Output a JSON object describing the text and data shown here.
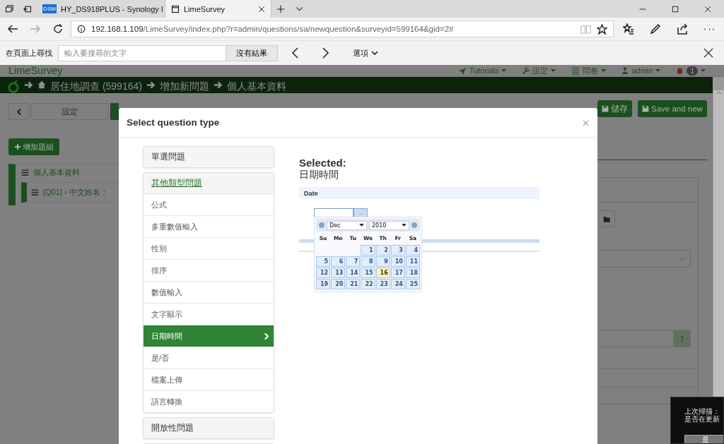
{
  "browser": {
    "tabs": [
      {
        "title": "HY_DS918PLUS - Synology I",
        "icon_text": "DSM",
        "selected": false
      },
      {
        "title": "LimeSurvey",
        "selected": true
      }
    ],
    "url_host": "192.168.1.109",
    "url_path": "/LimeSurvey/index.php?r=admin/questions/sa/newquestion&surveyid=599164&gid=2#"
  },
  "find_bar": {
    "label": "在頁面上尋找",
    "placeholder": "輸入要搜尋的文字",
    "result": "沒有結果",
    "options": "選項"
  },
  "navbar": {
    "brand": "LimeSurvey",
    "menus": [
      {
        "label": "Tutorials",
        "kind": "rocket"
      },
      {
        "label": "設定",
        "kind": "wrench"
      },
      {
        "label": "問卷",
        "kind": "list"
      },
      {
        "label": "admin",
        "kind": "user"
      }
    ],
    "notifications": "1"
  },
  "breadcrumb": [
    "居住地調查 (599164)",
    "增加新問題",
    "個人基本資料"
  ],
  "sidebar": {
    "settings_tab": "設定",
    "add_group": "增加題組",
    "tree": [
      {
        "label": "個人基本資料",
        "children": [
          {
            "label": "[Q01] › 中文姓名："
          }
        ]
      }
    ]
  },
  "toolbar": {
    "buttons": [
      "儲存",
      "Save and new"
    ]
  },
  "modal": {
    "title": "Select question type",
    "groups": [
      {
        "label": "單選問題",
        "expanded": false
      },
      {
        "label": "其他類型問題",
        "expanded": true,
        "items": [
          {
            "label": "公式",
            "selected": false
          },
          {
            "label": "多重數值輸入",
            "selected": false
          },
          {
            "label": "性別",
            "selected": false
          },
          {
            "label": "排序",
            "selected": false
          },
          {
            "label": "數值輸入",
            "selected": false
          },
          {
            "label": "文字顯示",
            "selected": false
          },
          {
            "label": "日期時間",
            "selected": true
          },
          {
            "label": "是/否",
            "selected": false
          },
          {
            "label": "檔案上傳",
            "selected": false
          },
          {
            "label": "語言轉換",
            "selected": false
          }
        ]
      },
      {
        "label": "開放性問題",
        "expanded": false
      }
    ],
    "selected_heading": "Selected:",
    "selected_type": "日期時間",
    "preview": {
      "question": "Date",
      "button": "...",
      "calendar": {
        "month": "Dec",
        "year": "2010",
        "weekdays": [
          "Su",
          "Mo",
          "Tu",
          "We",
          "Th",
          "Fr",
          "Sa"
        ],
        "weeks": [
          [
            {
              "day": "1",
              "today": false
            },
            {
              "day": "2",
              "today": false
            },
            {
              "day": "3",
              "today": false
            },
            {
              "day": "4",
              "today": false
            }
          ],
          [
            {
              "day": "5",
              "today": false
            },
            {
              "day": "6",
              "today": false
            },
            {
              "day": "7",
              "today": false
            },
            {
              "day": "8",
              "today": false
            },
            {
              "day": "9",
              "today": false
            },
            {
              "day": "10",
              "today": false
            },
            {
              "day": "11",
              "today": false
            }
          ],
          [
            {
              "day": "12",
              "today": false
            },
            {
              "day": "13",
              "today": false
            },
            {
              "day": "14",
              "today": false
            },
            {
              "day": "15",
              "today": false
            },
            {
              "day": "16",
              "today": true
            },
            {
              "day": "17",
              "today": false
            },
            {
              "day": "18",
              "today": false
            }
          ],
          [
            {
              "day": "19",
              "today": false
            },
            {
              "day": "20",
              "today": false
            },
            {
              "day": "21",
              "today": false
            },
            {
              "day": "22",
              "today": false
            },
            {
              "day": "23",
              "today": false
            },
            {
              "day": "24",
              "today": false
            },
            {
              "day": "25",
              "today": false
            }
          ]
        ]
      }
    }
  },
  "notice": {
    "lines": [
      "上次掃描：",
      "是否在更新"
    ],
    "button": "是"
  }
}
